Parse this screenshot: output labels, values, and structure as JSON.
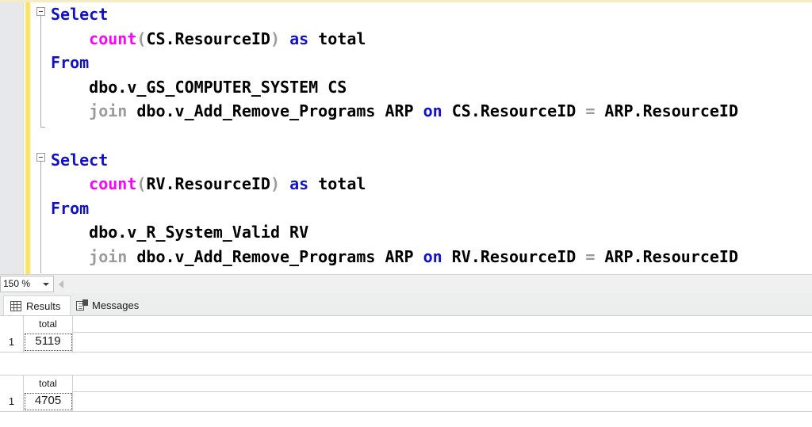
{
  "editor": {
    "zoom_level": "150 %",
    "lines": [
      [
        {
          "t": "Select",
          "c": "kw"
        }
      ],
      [
        {
          "t": "    ",
          "c": "plain"
        },
        {
          "t": "count",
          "c": "fn"
        },
        {
          "t": "(",
          "c": "punc"
        },
        {
          "t": "CS.ResourceID",
          "c": "plain"
        },
        {
          "t": ")",
          "c": "punc"
        },
        {
          "t": " ",
          "c": "plain"
        },
        {
          "t": "as",
          "c": "kw"
        },
        {
          "t": " total",
          "c": "plain"
        }
      ],
      [
        {
          "t": "From",
          "c": "kw"
        }
      ],
      [
        {
          "t": "    dbo.v_GS_COMPUTER_SYSTEM CS",
          "c": "plain"
        }
      ],
      [
        {
          "t": "    ",
          "c": "plain"
        },
        {
          "t": "join",
          "c": "punc"
        },
        {
          "t": " dbo.v_Add_Remove_Programs ARP ",
          "c": "plain"
        },
        {
          "t": "on",
          "c": "kw"
        },
        {
          "t": " CS.ResourceID ",
          "c": "plain"
        },
        {
          "t": "=",
          "c": "op"
        },
        {
          "t": " ARP.ResourceID",
          "c": "plain"
        }
      ],
      [],
      [
        {
          "t": "Select",
          "c": "kw"
        }
      ],
      [
        {
          "t": "    ",
          "c": "plain"
        },
        {
          "t": "count",
          "c": "fn"
        },
        {
          "t": "(",
          "c": "punc"
        },
        {
          "t": "RV.ResourceID",
          "c": "plain"
        },
        {
          "t": ")",
          "c": "punc"
        },
        {
          "t": " ",
          "c": "plain"
        },
        {
          "t": "as",
          "c": "kw"
        },
        {
          "t": " total",
          "c": "plain"
        }
      ],
      [
        {
          "t": "From",
          "c": "kw"
        }
      ],
      [
        {
          "t": "    dbo.v_R_System_Valid RV",
          "c": "plain"
        }
      ],
      [
        {
          "t": "    ",
          "c": "plain"
        },
        {
          "t": "join",
          "c": "punc"
        },
        {
          "t": " dbo.v_Add_Remove_Programs ARP ",
          "c": "plain"
        },
        {
          "t": "on",
          "c": "kw"
        },
        {
          "t": " RV.ResourceID ",
          "c": "plain"
        },
        {
          "t": "=",
          "c": "op"
        },
        {
          "t": " ARP.ResourceID",
          "c": "plain"
        }
      ]
    ]
  },
  "results_panel": {
    "tabs": [
      {
        "label": "Results",
        "icon": "grid-icon",
        "active": true
      },
      {
        "label": "Messages",
        "icon": "messages-icon",
        "active": false
      }
    ],
    "grids": [
      {
        "columns": [
          "total"
        ],
        "rows": [
          {
            "number": "1",
            "values": [
              "5119"
            ]
          }
        ]
      },
      {
        "columns": [
          "total"
        ],
        "rows": [
          {
            "number": "1",
            "values": [
              "4705"
            ]
          }
        ]
      }
    ]
  },
  "colors": {
    "keyword": "#1111cc",
    "function": "#ff00ff",
    "punctuation": "#9b9b9b",
    "change_bar": "#f5e15a",
    "indicator_margin": "#e6e8ea"
  }
}
